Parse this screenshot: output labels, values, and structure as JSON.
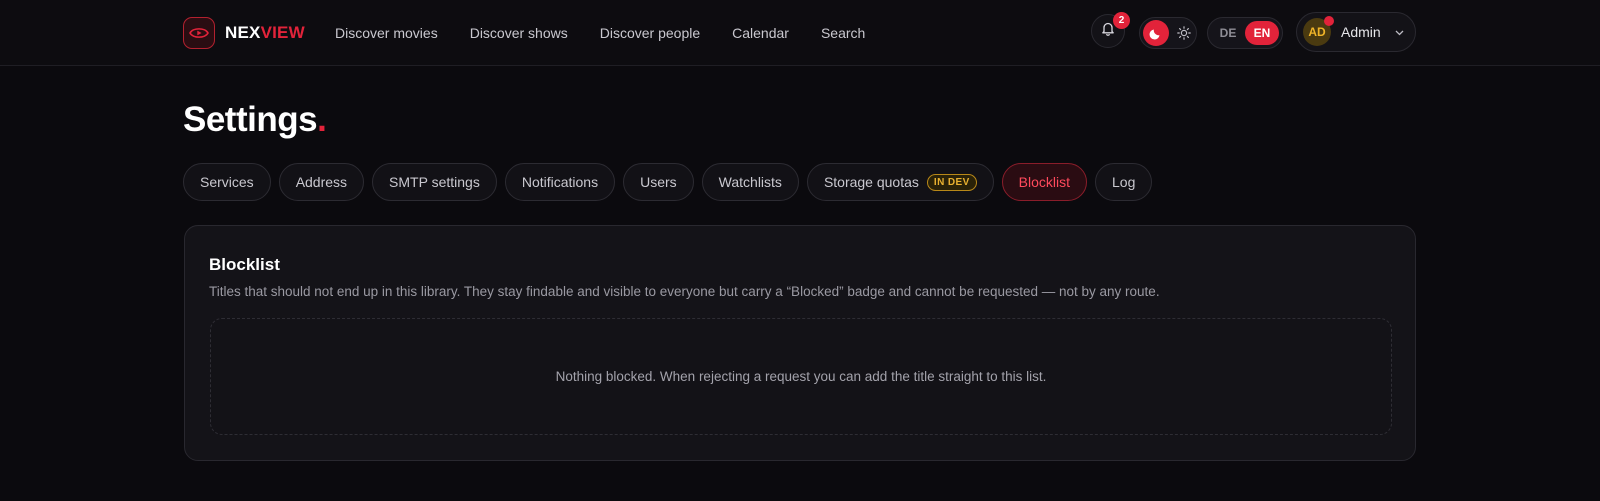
{
  "brand": {
    "part1": "NEX",
    "part2": "VIEW",
    "accent": "#e2233a"
  },
  "nav": [
    {
      "label": "Discover movies"
    },
    {
      "label": "Discover shows"
    },
    {
      "label": "Discover people"
    },
    {
      "label": "Calendar"
    },
    {
      "label": "Search"
    }
  ],
  "header": {
    "notifications_count": "2",
    "theme": {
      "active": "dark",
      "icons": [
        "moon-icon",
        "sun-icon"
      ]
    },
    "language": {
      "options": [
        "DE",
        "EN"
      ],
      "selected": "EN"
    },
    "user": {
      "initials": "AD",
      "name": "Admin"
    }
  },
  "page": {
    "title": "Settings",
    "title_dot": "."
  },
  "tabs": [
    {
      "label": "Services"
    },
    {
      "label": "Address"
    },
    {
      "label": "SMTP settings"
    },
    {
      "label": "Notifications"
    },
    {
      "label": "Users"
    },
    {
      "label": "Watchlists"
    },
    {
      "label": "Storage quotas",
      "badge": "IN DEV"
    },
    {
      "label": "Blocklist",
      "active": true
    },
    {
      "label": "Log"
    }
  ],
  "panel": {
    "title": "Blocklist",
    "description": "Titles that should not end up in this library. They stay findable and visible to everyone but carry a “Blocked” badge and cannot be requested — not by any route.",
    "empty_message": "Nothing blocked. When rejecting a request you can add the title straight to this list."
  }
}
